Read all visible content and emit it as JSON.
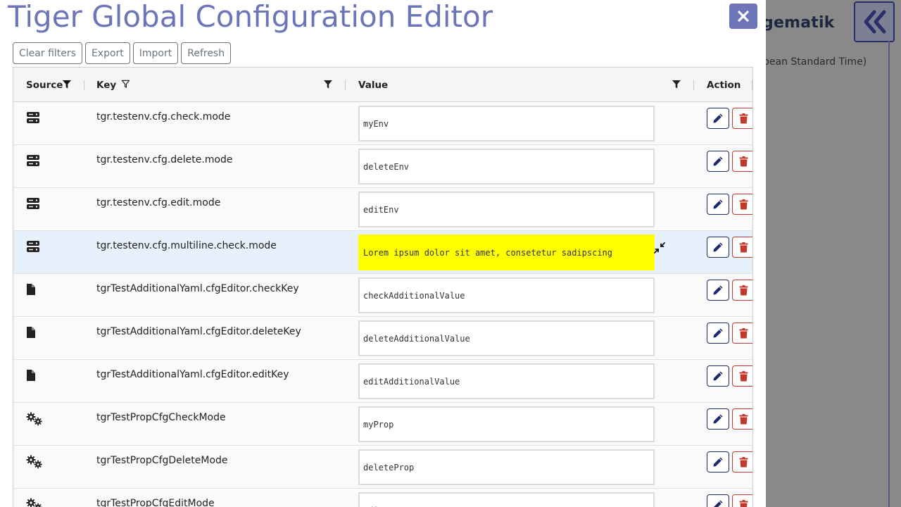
{
  "background": {
    "brand": "gematik",
    "timezone_text": "pean Standard Time)"
  },
  "modal": {
    "title": "Tiger Global Configuration Editor",
    "close_icon": "close-icon"
  },
  "toolbar": {
    "clear_filters": "Clear filters",
    "export": "Export",
    "import": "Import",
    "refresh": "Refresh"
  },
  "columns": {
    "source": "Source",
    "key": "Key",
    "value": "Value",
    "action": "Action"
  },
  "rows": [
    {
      "source_icon": "server-icon",
      "key": "tgr.testenv.cfg.check.mode",
      "value": "myEnv"
    },
    {
      "source_icon": "server-icon",
      "key": "tgr.testenv.cfg.delete.mode",
      "value": "deleteEnv"
    },
    {
      "source_icon": "server-icon",
      "key": "tgr.testenv.cfg.edit.mode",
      "value": "editEnv"
    },
    {
      "source_icon": "server-icon",
      "key": "tgr.testenv.cfg.multiline.check.mode",
      "value": "Lorem ipsum dolor sit amet, consetetur sadipscing",
      "highlighted": true,
      "selected": true
    },
    {
      "source_icon": "file-icon",
      "key": "tgrTestAdditionalYaml.cfgEditor.checkKey",
      "value": "checkAdditionalValue"
    },
    {
      "source_icon": "file-icon",
      "key": "tgrTestAdditionalYaml.cfgEditor.deleteKey",
      "value": "deleteAdditionalValue"
    },
    {
      "source_icon": "file-icon",
      "key": "tgrTestAdditionalYaml.cfgEditor.editKey",
      "value": "editAdditionalValue"
    },
    {
      "source_icon": "gears-icon",
      "key": "tgrTestPropCfgCheckMode",
      "value": "myProp"
    },
    {
      "source_icon": "gears-icon",
      "key": "tgrTestPropCfgDeleteMode",
      "value": "deleteProp"
    },
    {
      "source_icon": "gears-icon",
      "key": "tgrTestPropCfgEditMode",
      "value": "editProp"
    }
  ],
  "colors": {
    "title": "#6b75b8",
    "highlight": "#ffff00",
    "edit": "#1c2a6b",
    "delete": "#c0392b"
  }
}
